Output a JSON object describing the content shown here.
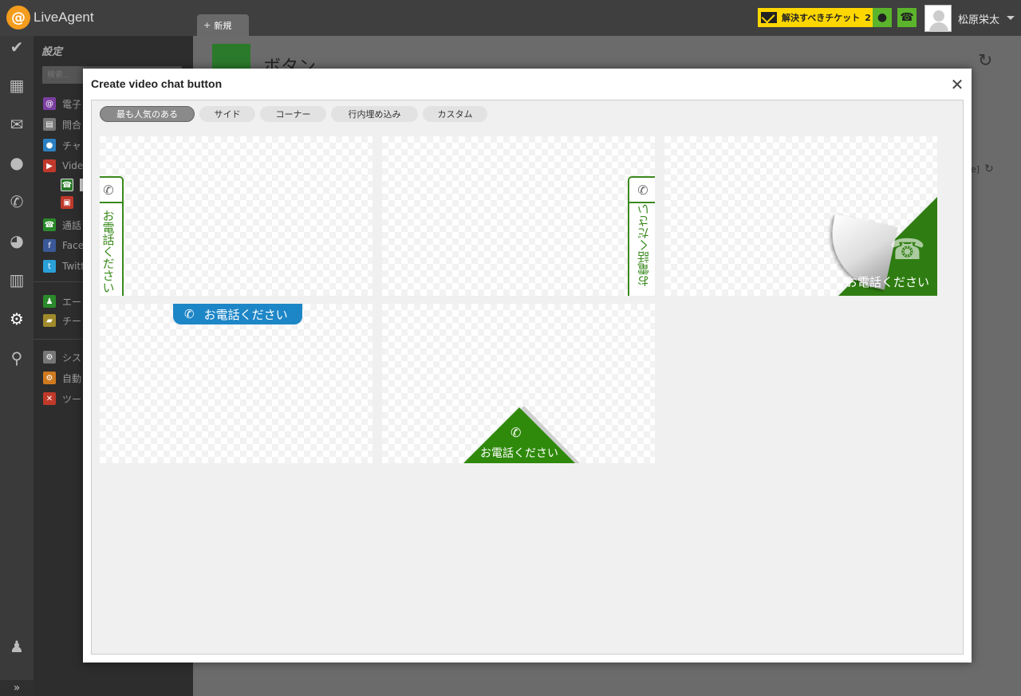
{
  "app": {
    "logo_text": "LiveAgent",
    "new_tab_label": "新規",
    "ticket_badge_label": "解決すべきチケット",
    "ticket_badge_count": "2",
    "user_name": "松原栄太"
  },
  "settings": {
    "title": "設定",
    "search_placeholder": "検索...",
    "menu": [
      {
        "label": "電子",
        "icon": "email-icon",
        "color": "#7b3fa0"
      },
      {
        "label": "問合",
        "icon": "contact-form-icon",
        "color": "#777777"
      },
      {
        "label": "チャ",
        "icon": "chat-icon",
        "color": "#2b7fc0"
      },
      {
        "label": "Vide",
        "icon": "video-icon",
        "color": "#c0392b"
      },
      {
        "label": "通話",
        "icon": "call-icon",
        "color": "#2b8a2b"
      },
      {
        "label": "Face",
        "icon": "facebook-icon",
        "color": "#3b5998"
      },
      {
        "label": "Twitt",
        "icon": "twitter-icon",
        "color": "#2aa0d8"
      },
      {
        "label": "エー",
        "icon": "agents-icon",
        "color": "#2b8a2b"
      },
      {
        "label": "チー",
        "icon": "teams-icon",
        "color": "#a08a2b"
      },
      {
        "label": "シス",
        "icon": "system-gear-icon",
        "color": "#777777"
      },
      {
        "label": "自動",
        "icon": "automation-icon",
        "color": "#d07a20"
      },
      {
        "label": "ツー",
        "icon": "tools-icon",
        "color": "#c0392b"
      }
    ]
  },
  "page": {
    "title": "ボタン"
  },
  "modal": {
    "title": "Create video chat button",
    "tabs": [
      {
        "label": "最も人気のある",
        "active": true
      },
      {
        "label": "サイド",
        "active": false
      },
      {
        "label": "コーナー",
        "active": false
      },
      {
        "label": "行内埋め込み",
        "active": false
      },
      {
        "label": "カスタム",
        "active": false
      }
    ],
    "button_text": "お電話ください"
  },
  "colors": {
    "green": "#2f7d12",
    "blue": "#1d86c7",
    "ticket_yellow": "#ffd700"
  }
}
